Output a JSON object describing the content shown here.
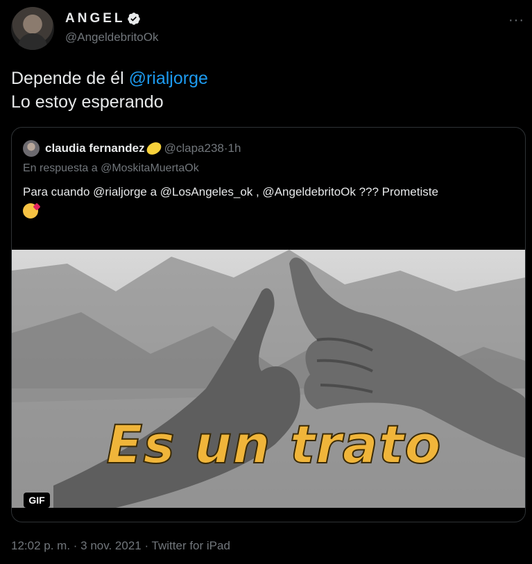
{
  "author": {
    "name": "ANGEL",
    "handle": "@AngeldebritoOk",
    "verified_icon": "verified-badge-icon"
  },
  "more_icon": "···",
  "tweet": {
    "line1_prefix": "Depende de él ",
    "line1_mention": "@rialjorge",
    "line2": "Lo estoy esperando"
  },
  "quoted_tweet": {
    "name": "claudia fernandez",
    "handle": "@clapa238",
    "separator": " · ",
    "time": "1h",
    "reply_prefix": "En respuesta a ",
    "reply_to": "@MoskitaMuertaOk",
    "body": "Para cuando @rialjorge  a @LosAngeles_ok , @AngeldebritoOk ??? Prometiste",
    "media": {
      "caption": "Es un trato",
      "badge": "GIF"
    }
  },
  "meta": {
    "timestamp": "12:02 p. m. · 3 nov. 2021 · Twitter for iPad"
  },
  "colors": {
    "background": "#000000",
    "text": "#e7e9ea",
    "secondary": "#71767b",
    "link": "#1d9bf0",
    "caption": "#f0b53a"
  }
}
